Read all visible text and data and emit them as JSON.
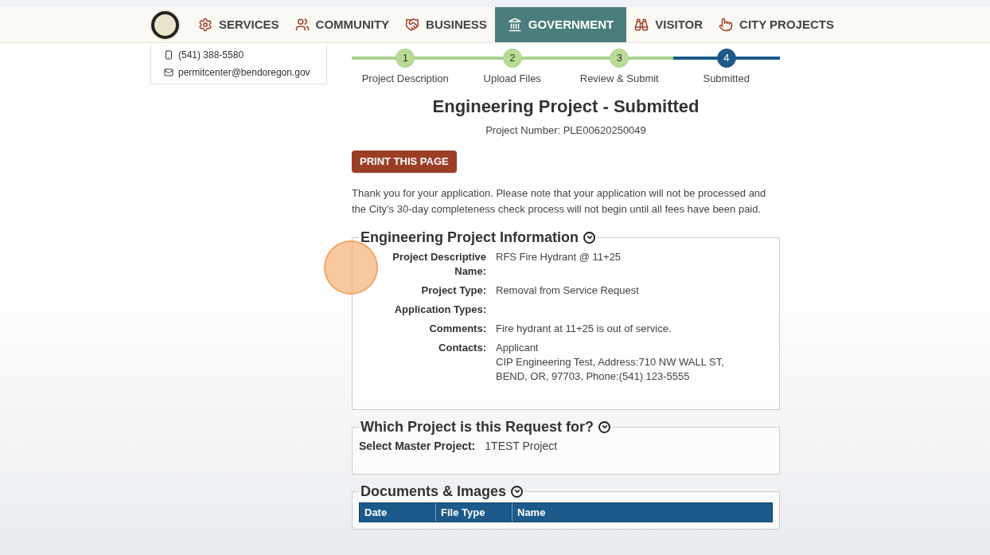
{
  "nav": {
    "items": [
      {
        "label": "SERVICES",
        "kind": "gears",
        "selected": false
      },
      {
        "label": "COMMUNITY",
        "kind": "people",
        "selected": false
      },
      {
        "label": "BUSINESS",
        "kind": "handshake",
        "selected": false
      },
      {
        "label": "GOVERNMENT",
        "kind": "building",
        "selected": true
      },
      {
        "label": "VISITOR",
        "kind": "binoculars",
        "selected": false
      },
      {
        "label": "CITY PROJECTS",
        "kind": "pointer",
        "selected": false
      }
    ]
  },
  "sidebar": {
    "phone": "(541) 388-5580",
    "email": "permitcenter@bendoregon.gov"
  },
  "steps": [
    {
      "number": "1",
      "label": "Project Description",
      "selected": false
    },
    {
      "number": "2",
      "label": "Upload Files",
      "selected": false
    },
    {
      "number": "3",
      "label": "Review & Submit",
      "selected": false
    },
    {
      "number": "4",
      "label": "Submitted",
      "selected": true
    }
  ],
  "title": "Engineering Project - Submitted",
  "project_number": "Project Number: PLE00620250049",
  "print_button": "PRINT THIS PAGE",
  "notice": "Thank you for your application. Please note that your application will not be processed and the City's 30-day completeness check process will not begin until all fees have been paid.",
  "sections": [
    {
      "title": "Engineering Project Information",
      "kind": "details",
      "fields": [
        {
          "label": "Project Descriptive Name:",
          "value": "RFS Fire Hydrant @ 11+25"
        },
        {
          "label": "Project Type:",
          "value": "Removal from Service Request"
        },
        {
          "label": "Application Types:"
        },
        {
          "label": "Comments:",
          "value": "Fire hydrant at 11+25 is out of service."
        },
        {
          "label": "Contacts:",
          "value": "Applicant",
          "extra": "CIP Engineering Test, Address:710 NW WALL ST, BEND, OR, 97703, Phone:(541) 123-5555"
        }
      ]
    },
    {
      "title": "Which Project is this Request for?",
      "kind": "inline",
      "fields": [
        {
          "label": "Select Master Project:",
          "value": "1TEST Project"
        }
      ]
    },
    {
      "title": "Documents & Images",
      "kind": "table",
      "columns": [
        "Date",
        "File Type",
        "Name"
      ]
    }
  ]
}
